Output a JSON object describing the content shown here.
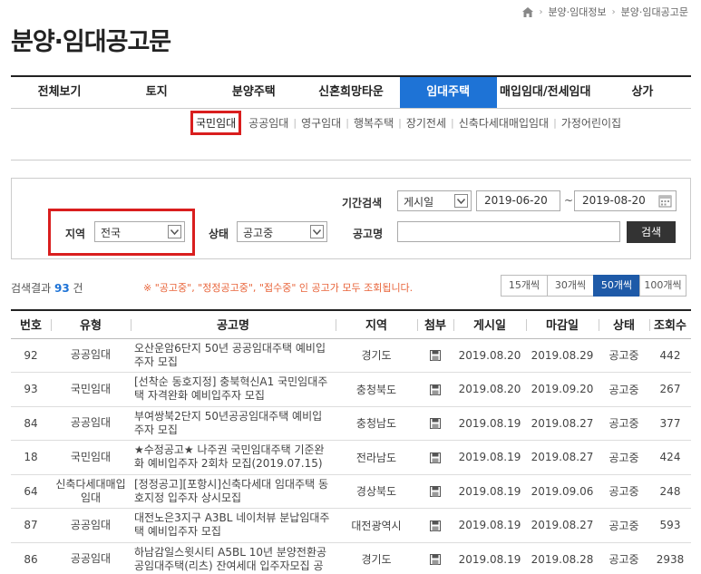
{
  "breadcrumb": {
    "items": [
      "분양·임대정보",
      "분양·임대공고문"
    ]
  },
  "page_title": "분양·임대공고문",
  "tabs": [
    "전체보기",
    "토지",
    "분양주택",
    "신혼희망타운",
    "임대주택",
    "매입임대/전세임대",
    "상가"
  ],
  "active_tab": "임대주택",
  "subtabs": [
    "국민임대",
    "공공임대",
    "영구임대",
    "행복주택",
    "장기전세",
    "신축다세대매입임대",
    "가정어린이집"
  ],
  "search": {
    "period_label": "기간검색",
    "period_type": "게시일",
    "date_from": "2019-06-20",
    "tilde": "~",
    "date_to": "2019-08-20",
    "region_label": "지역",
    "region_value": "전국",
    "status_label": "상태",
    "status_value": "공고중",
    "name_label": "공고명",
    "name_value": "",
    "search_button": "검색"
  },
  "results": {
    "prefix": "검색결과",
    "count": "93",
    "suffix": "건"
  },
  "notice": "※ \"공고중\", \"정정공고중\", \"접수중\" 인 공고가 모두 조회됩니다.",
  "page_sizes": [
    "15개씩",
    "30개씩",
    "50개씩",
    "100개씩"
  ],
  "active_page_size": "50개씩",
  "table": {
    "headers": [
      "번호",
      "유형",
      "공고명",
      "지역",
      "첨부",
      "게시일",
      "마감일",
      "상태",
      "조회수"
    ],
    "rows": [
      {
        "no": "92",
        "type": "공공임대",
        "title": "오산운암6단지 50년 공공임대주택 예비입주자 모집",
        "region": "경기도",
        "posted": "2019.08.20",
        "deadline": "2019.08.29",
        "status": "공고중",
        "views": "442"
      },
      {
        "no": "93",
        "type": "국민임대",
        "title": "[선착순 동호지정] 충북혁신A1 국민임대주택 자격완화 예비입주자 모집",
        "region": "충청북도",
        "posted": "2019.08.20",
        "deadline": "2019.09.20",
        "status": "공고중",
        "views": "267"
      },
      {
        "no": "84",
        "type": "공공임대",
        "title": "부여쌍북2단지 50년공공임대주택 예비입주자 모집",
        "region": "충청남도",
        "posted": "2019.08.19",
        "deadline": "2019.08.27",
        "status": "공고중",
        "views": "377"
      },
      {
        "no": "18",
        "type": "국민임대",
        "title": "★수정공고★ 나주권 국민임대주택 기준완화 예비입주자 2회차 모집(2019.07.15)",
        "region": "전라남도",
        "posted": "2019.08.19",
        "deadline": "2019.08.27",
        "status": "공고중",
        "views": "424"
      },
      {
        "no": "64",
        "type": "신축다세대매입임대",
        "title": "[정정공고][포항시]신축다세대 임대주택 동호지정 입주자 상시모집",
        "region": "경상북도",
        "posted": "2019.08.19",
        "deadline": "2019.09.06",
        "status": "공고중",
        "views": "248"
      },
      {
        "no": "87",
        "type": "공공임대",
        "title": "대전노은3지구 A3BL 네이처뷰 분납임대주택 예비입주자 모집",
        "region": "대전광역시",
        "posted": "2019.08.19",
        "deadline": "2019.08.27",
        "status": "공고중",
        "views": "593"
      },
      {
        "no": "86",
        "type": "공공임대",
        "title": "하남감일스윗시티 A5BL 10년 분양전환공공임대주택(리츠) 잔여세대 입주자모집 공",
        "region": "경기도",
        "posted": "2019.08.19",
        "deadline": "2019.08.28",
        "status": "공고중",
        "views": "2938"
      }
    ]
  }
}
